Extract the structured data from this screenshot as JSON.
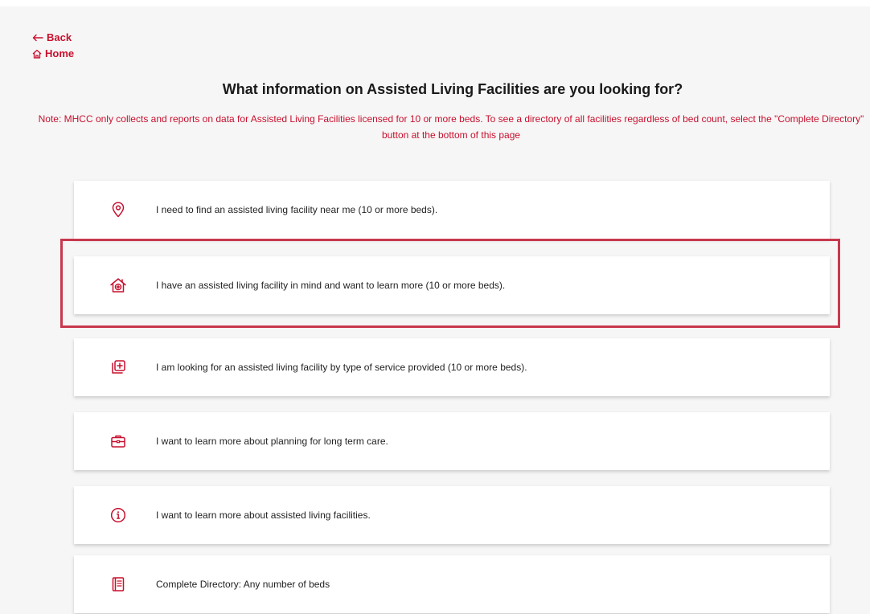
{
  "nav": {
    "back_label": "Back",
    "home_label": "Home"
  },
  "header": {
    "title": "What information on Assisted Living Facilities are you looking for?",
    "note": "Note: MHCC only collects and reports on data for Assisted Living Facilities licensed for 10 or more beds. To see a directory of all facilities regardless of bed count, select the \"Complete Directory\" button at the bottom of this page"
  },
  "options": [
    {
      "icon": "location-pin-icon",
      "label": "I need to find an assisted living facility near me (10 or more beds)."
    },
    {
      "icon": "house-medical-icon",
      "label": "I have an assisted living facility in mind and want to learn more (10 or more beds)."
    },
    {
      "icon": "medical-copy-icon",
      "label": "I am looking for an assisted living facility by type of service provided (10 or more beds)."
    },
    {
      "icon": "briefcase-icon",
      "label": "I want to learn more about planning for long term care."
    },
    {
      "icon": "info-circle-icon",
      "label": "I want to learn more about assisted living facilities."
    },
    {
      "icon": "book-icon",
      "label": "Complete Directory: Any number of beds"
    }
  ],
  "colors": {
    "accent": "#c8102e",
    "highlight_border": "#c8384e",
    "page_background": "#f6f6f6"
  }
}
